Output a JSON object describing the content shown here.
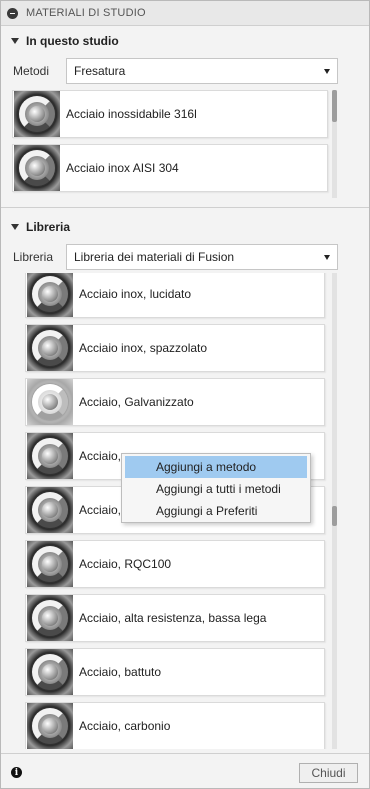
{
  "panel": {
    "title": "MATERIALI DI STUDIO"
  },
  "studio": {
    "heading": "In questo studio",
    "method_label": "Metodi",
    "method_value": "Fresatura",
    "items": [
      {
        "label": "Acciaio inossidabile 316l",
        "icon": "steel-material-icon"
      },
      {
        "label": "Acciaio inox AISI 304",
        "icon": "steel-material-icon"
      }
    ]
  },
  "library": {
    "heading": "Libreria",
    "library_label": "Libreria",
    "library_value": "Libreria dei materiali di Fusion",
    "items": [
      {
        "label": "Acciaio inox, lucidato",
        "icon": "steel-material-icon"
      },
      {
        "label": "Acciaio inox, spazzolato",
        "icon": "steel-material-icon"
      },
      {
        "label": "Acciaio, Galvanizzato",
        "icon": "galvanized-material-icon"
      },
      {
        "label": "Acciaio,",
        "icon": "steel-material-icon"
      },
      {
        "label": "Acciaio,",
        "icon": "steel-material-icon"
      },
      {
        "label": "Acciaio, RQC100",
        "icon": "steel-material-icon"
      },
      {
        "label": "Acciaio, alta resistenza, bassa lega",
        "icon": "steel-material-icon"
      },
      {
        "label": "Acciaio, battuto",
        "icon": "steel-material-icon"
      },
      {
        "label": "Acciaio, carbonio",
        "icon": "steel-material-icon"
      }
    ]
  },
  "context_menu": {
    "items": [
      {
        "label": "Aggiungi a metodo",
        "highlighted": true
      },
      {
        "label": "Aggiungi a tutti i metodi",
        "highlighted": false
      },
      {
        "label": "Aggiungi a Preferiti",
        "highlighted": false
      }
    ]
  },
  "footer": {
    "info_icon": "info-icon",
    "close_label": "Chiudi"
  }
}
